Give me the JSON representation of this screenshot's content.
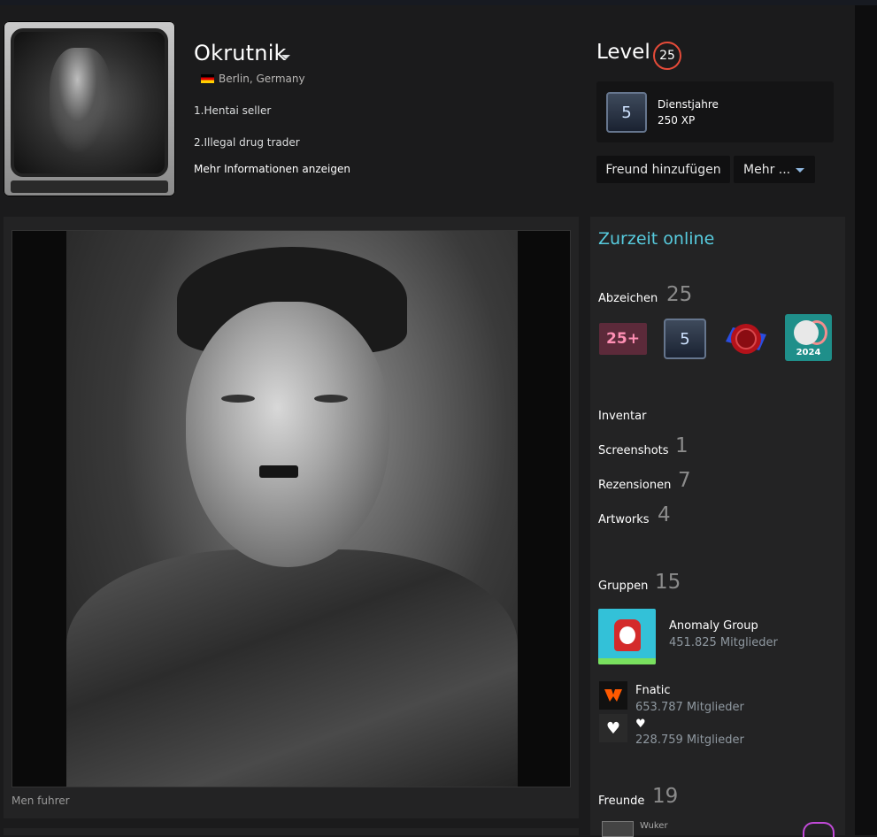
{
  "profile": {
    "persona_name": "Okrutnik",
    "location": "Berlin, Germany",
    "summary_lines": [
      "1.Hentai seller",
      "2.Illegal drug trader"
    ],
    "more_info_link": "Mehr Informationen anzeigen"
  },
  "level": {
    "label": "Level",
    "value": "25",
    "ring_color": "#e54b39"
  },
  "years_badge": {
    "icon_text": "5",
    "title": "Dienstjahre",
    "xp": "250 XP"
  },
  "actions": {
    "add_friend": "Freund hinzufügen",
    "more": "Mehr ..."
  },
  "showcase": {
    "artwork_caption": "Men fuhrer"
  },
  "sidebar": {
    "status": "Zurzeit online",
    "status_color": "#57cbde",
    "badges_label": "Abzeichen",
    "badges_count": "25",
    "badges": [
      {
        "name": "level-25-plus-badge",
        "text": "25+"
      },
      {
        "name": "years-of-service-badge",
        "text": "5"
      },
      {
        "name": "wax-seal-badge",
        "text": ""
      },
      {
        "name": "steam-2024-badge",
        "text": "2024"
      }
    ],
    "links": [
      {
        "label": "Inventar",
        "count": ""
      },
      {
        "label": "Screenshots",
        "count": "1"
      },
      {
        "label": "Rezensionen",
        "count": "7"
      },
      {
        "label": "Artworks",
        "count": "4"
      }
    ],
    "groups_label": "Gruppen",
    "groups_count": "15",
    "groups": [
      {
        "name": "Anomaly Group",
        "members": "451.825 Mitglieder"
      },
      {
        "name": "Fnatic",
        "members": "653.787 Mitglieder"
      },
      {
        "name": "♥",
        "members": "228.759 Mitglieder"
      }
    ],
    "friends_label": "Freunde",
    "friends_count": "19",
    "friend_preview_name": "Wuker"
  }
}
